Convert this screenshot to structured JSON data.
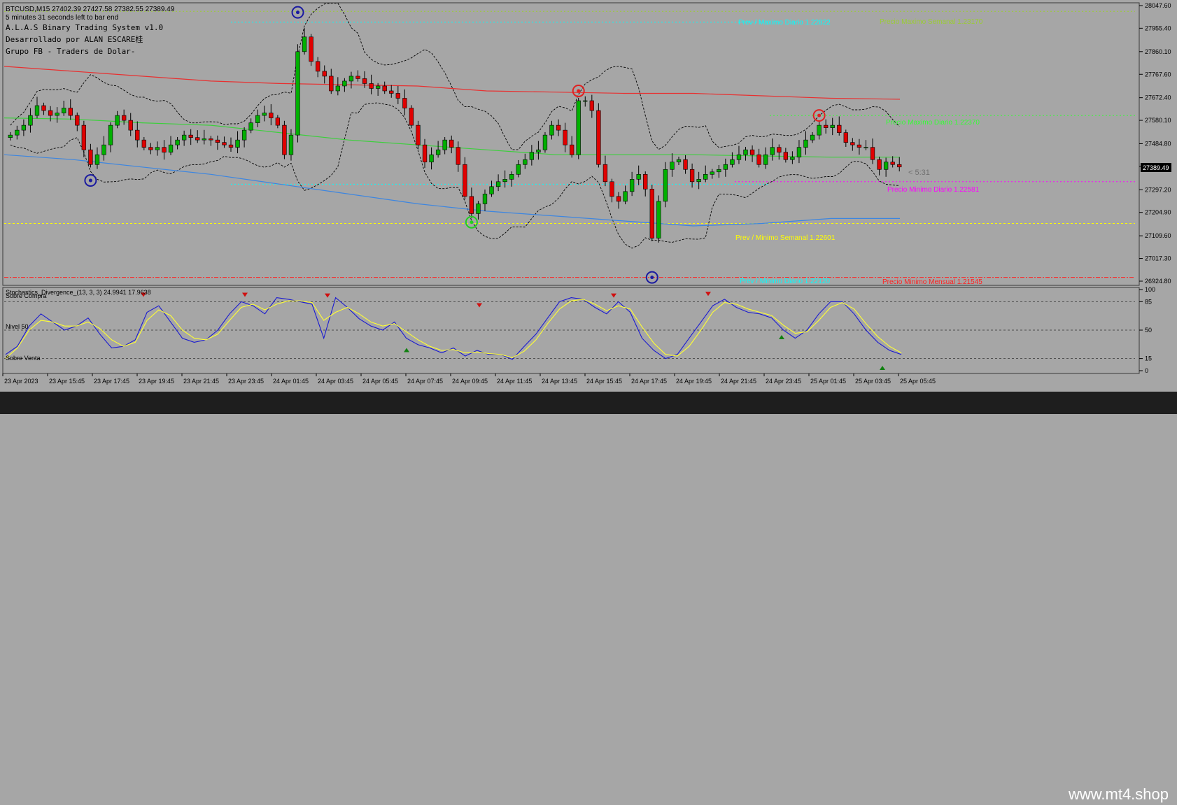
{
  "header": {
    "symbol_line": "BTCUSD,M15  27402.39 27427.58 27382.55 27389.49",
    "timer_line": "5 minutes 31 seconds left to bar end",
    "system_name": "A.L.A.S Binary Trading System v1.0",
    "developer": "Desarrollado por ALAN ESCARE桂",
    "group": "Grupo FB - Traders de Dolar-"
  },
  "price_levels": [
    {
      "label": "Prev / Maximo Diario 1.22822",
      "color": "#00ffff"
    },
    {
      "label": "Precio Maximo Semanal 1.23170",
      "color": "#9acd32"
    },
    {
      "label": "Precio Maximo Diario 1.22370",
      "color": "#33ff33"
    },
    {
      "label": "Precio Minimo Diario 1.22581",
      "color": "#ff00ff"
    },
    {
      "label": "Prev / Minimo Semanal 1.22601",
      "color": "#ffff00"
    },
    {
      "label": "Prev / Minimo Diario 1.22120",
      "color": "#00ffff"
    },
    {
      "label": "Precio Minimo Mensual 1.21545",
      "color": "#ff2020"
    }
  ],
  "countdown_label": "< 5:31",
  "current_price": "27389.49",
  "stochastic": {
    "title": "Stochastics_Divergence_(13, 3, 3) 24.9941 17.9638",
    "overbought_label": "Sobre Compra",
    "mid_label": "Nivel 50",
    "oversold_label": "Sobre Venta",
    "axis_ticks": [
      "100",
      "85",
      "50",
      "15",
      "0"
    ]
  },
  "watermark": "www.mt4.shop",
  "chart_data": [
    {
      "type": "candlestick",
      "title": "BTCUSD,M15",
      "ylim": [
        26924.8,
        28047.6
      ],
      "y_ticks": [
        "28047.60",
        "27955.40",
        "27860.10",
        "27767.60",
        "27672.40",
        "27580.10",
        "27484.80",
        "27392.50",
        "27297.20",
        "27204.90",
        "27109.60",
        "27017.30",
        "26924.80"
      ],
      "x_ticks": [
        "23 Apr 2023",
        "23 Apr 15:45",
        "23 Apr 17:45",
        "23 Apr 19:45",
        "23 Apr 21:45",
        "23 Apr 23:45",
        "24 Apr 01:45",
        "24 Apr 03:45",
        "24 Apr 05:45",
        "24 Apr 07:45",
        "24 Apr 09:45",
        "24 Apr 11:45",
        "24 Apr 13:45",
        "24 Apr 15:45",
        "24 Apr 17:45",
        "24 Apr 19:45",
        "24 Apr 21:45",
        "24 Apr 23:45",
        "25 Apr 01:45",
        "25 Apr 03:45",
        "25 Apr 05:45"
      ],
      "close": [
        27520,
        27540,
        27560,
        27600,
        27640,
        27620,
        27600,
        27610,
        27630,
        27600,
        27560,
        27460,
        27400,
        27440,
        27480,
        27560,
        27600,
        27580,
        27540,
        27500,
        27470,
        27460,
        27470,
        27450,
        27480,
        27500,
        27520,
        27510,
        27500,
        27505,
        27500,
        27490,
        27480,
        27470,
        27500,
        27540,
        27570,
        27600,
        27610,
        27590,
        27560,
        27440,
        27520,
        27860,
        27920,
        27820,
        27780,
        27760,
        27700,
        27720,
        27740,
        27760,
        27750,
        27730,
        27710,
        27720,
        27700,
        27690,
        27670,
        27630,
        27560,
        27480,
        27410,
        27440,
        27460,
        27500,
        27470,
        27400,
        27270,
        27200,
        27240,
        27280,
        27310,
        27330,
        27340,
        27360,
        27400,
        27420,
        27450,
        27460,
        27520,
        27560,
        27540,
        27480,
        27440,
        27660,
        27660,
        27620,
        27400,
        27330,
        27270,
        27250,
        27290,
        27340,
        27360,
        27300,
        27100,
        27250,
        27380,
        27410,
        27420,
        27380,
        27330,
        27340,
        27360,
        27370,
        27380,
        27400,
        27420,
        27440,
        27460,
        27440,
        27400,
        27440,
        27470,
        27450,
        27420,
        27430,
        27470,
        27500,
        27520,
        27560,
        27550,
        27560,
        27530,
        27490,
        27480,
        27470,
        27470,
        27420,
        27380,
        27410,
        27400,
        27390
      ],
      "ma_red": [
        27800,
        27780,
        27760,
        27740,
        27730,
        27725,
        27720,
        27700,
        27695,
        27690,
        27690,
        27680,
        27670,
        27666
      ],
      "ma_green": [
        27590,
        27585,
        27570,
        27560,
        27530,
        27500,
        27480,
        27460,
        27440,
        27440,
        27440,
        27435,
        27430,
        27430
      ],
      "ma_blue": [
        27440,
        27420,
        27390,
        27360,
        27320,
        27280,
        27240,
        27210,
        27190,
        27170,
        27150,
        27160,
        27180,
        27180
      ]
    },
    {
      "type": "line",
      "title": "Stochastics_Divergence_(13, 3, 3)",
      "ylim": [
        0,
        100
      ],
      "levels": [
        15,
        50,
        85
      ],
      "series": [
        {
          "values": [
            20,
            30,
            55,
            70,
            60,
            50,
            55,
            65,
            45,
            28,
            30,
            38,
            72,
            80,
            60,
            40,
            35,
            38,
            50,
            70,
            85,
            80,
            70,
            90,
            88,
            85,
            82,
            40,
            90,
            78,
            64,
            55,
            50,
            60,
            40,
            32,
            28,
            22,
            28,
            18,
            25,
            20,
            20,
            14,
            30,
            45,
            65,
            85,
            90,
            88,
            78,
            70,
            85,
            72,
            40,
            25,
            15,
            20,
            40,
            60,
            80,
            88,
            78,
            72,
            70,
            65,
            50,
            40,
            50,
            70,
            85,
            85,
            70,
            50,
            35,
            25,
            20
          ]
        },
        {
          "values": [
            15,
            28,
            50,
            62,
            60,
            55,
            55,
            60,
            52,
            38,
            30,
            35,
            62,
            75,
            68,
            50,
            40,
            38,
            45,
            62,
            78,
            82,
            75,
            82,
            86,
            86,
            84,
            62,
            72,
            78,
            70,
            60,
            55,
            58,
            48,
            38,
            30,
            25,
            26,
            22,
            23,
            21,
            20,
            16,
            24,
            38,
            58,
            76,
            86,
            88,
            82,
            74,
            80,
            76,
            54,
            34,
            20,
            18,
            30,
            50,
            72,
            84,
            82,
            76,
            72,
            68,
            56,
            46,
            48,
            62,
            78,
            84,
            76,
            58,
            42,
            30,
            22
          ]
        }
      ]
    }
  ]
}
